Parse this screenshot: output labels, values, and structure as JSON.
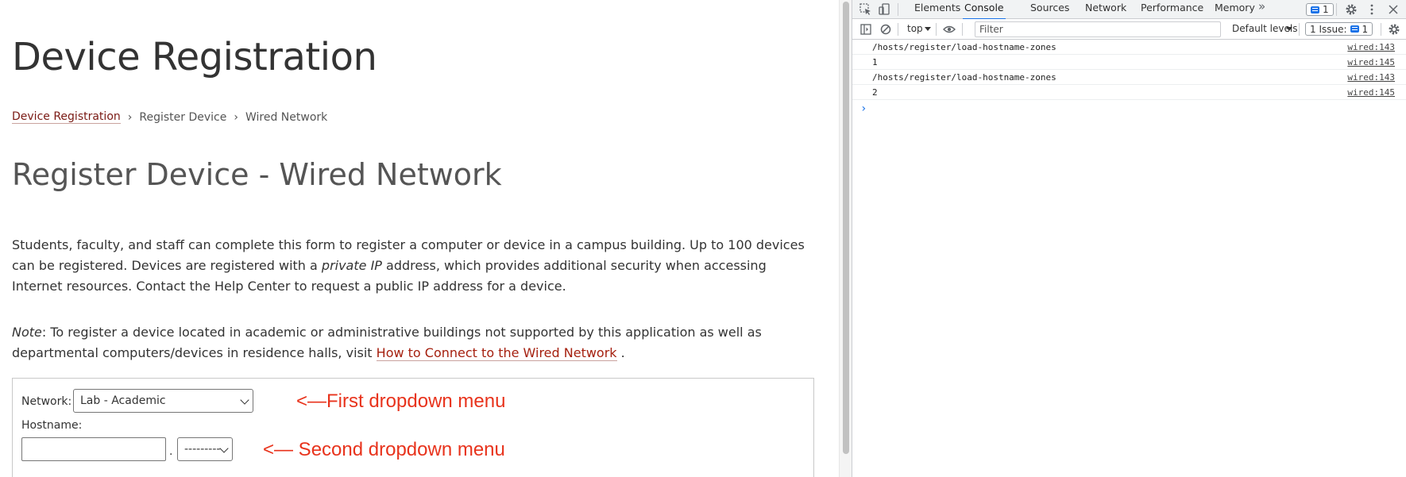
{
  "page": {
    "title": "Device Registration",
    "breadcrumb": [
      "Device Registration",
      "Register Device",
      "Wired Network"
    ],
    "breadcrumb_separator": "›",
    "heading": "Register Device - Wired Network",
    "intro": {
      "before": "Students, faculty, and staff can complete this form to register a computer or device in a campus building. Up to 100 devices can be registered. Devices are registered with a ",
      "emphasis": "private IP",
      "after": " address, which provides additional security when accessing Internet resources. Contact the Help Center to request a public IP address for a device."
    },
    "note": {
      "label": "Note",
      "text": ": To register a device located in academic or administrative buildings not supported by this application as well as departmental computers/devices in residence halls, visit ",
      "link": "How to Connect to the Wired Network",
      "end": " ."
    },
    "form": {
      "network_label": "Network:",
      "network_value": "Lab - Academic",
      "hostname_label": "Hostname:",
      "hostname_value": "",
      "dot": ".",
      "zone_value": "---------"
    },
    "annotations": {
      "first": "<—First dropdown menu",
      "second": "<— Second dropdown menu"
    }
  },
  "devtools": {
    "tabs": [
      "Elements",
      "Console",
      "Sources",
      "Network",
      "Performance",
      "Memory"
    ],
    "active_tab": "Console",
    "more": "»",
    "issue_badge_count": "1",
    "toolbar": {
      "context": "top",
      "filter_placeholder": "Filter",
      "levels": "Default levels",
      "issues_label": "1 Issue:",
      "issues_count": "1"
    },
    "console": [
      {
        "message": "/hosts/register/load-hostname-zones",
        "source": "wired:143"
      },
      {
        "message": "1",
        "source": "wired:145"
      },
      {
        "message": "/hosts/register/load-hostname-zones",
        "source": "wired:143"
      },
      {
        "message": "2",
        "source": "wired:145"
      }
    ],
    "prompt": "›"
  },
  "colors": {
    "link": "#a5200f",
    "annotation": "#e8331c",
    "devtools_accent": "#1a73e8"
  }
}
